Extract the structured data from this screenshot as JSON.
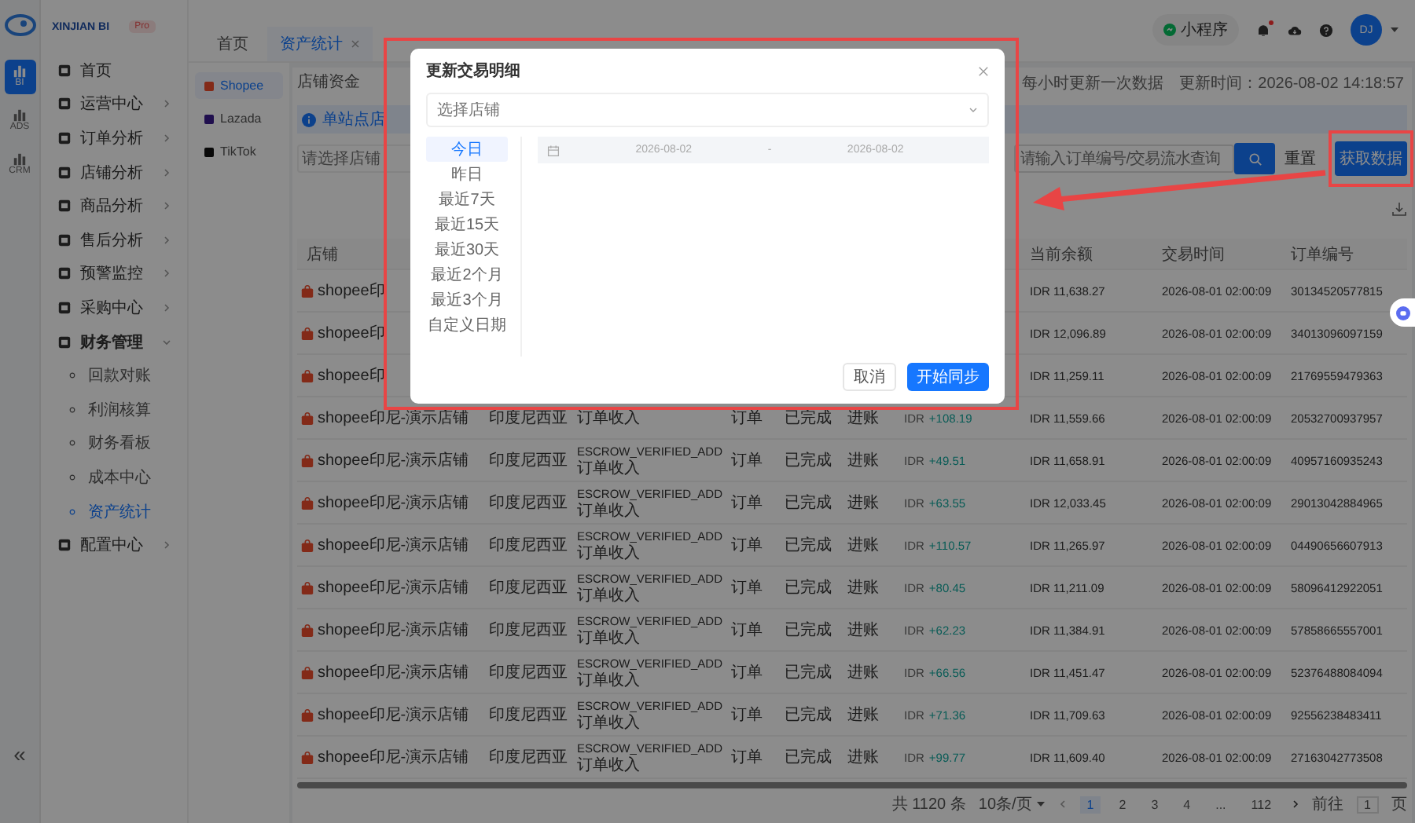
{
  "rail": {
    "items": [
      {
        "label": "BI",
        "selected": true
      },
      {
        "label": "ADS",
        "selected": false
      },
      {
        "label": "CRM",
        "selected": false
      }
    ],
    "collapse": "«"
  },
  "sidebar": {
    "brand": "XINJIAN BI",
    "badge": "Pro",
    "items": [
      {
        "label": "首页",
        "kind": "link"
      },
      {
        "label": "运营中心",
        "kind": "group",
        "expanded": false
      },
      {
        "label": "订单分析",
        "kind": "group",
        "expanded": false
      },
      {
        "label": "店铺分析",
        "kind": "group",
        "expanded": false
      },
      {
        "label": "商品分析",
        "kind": "group",
        "expanded": false
      },
      {
        "label": "售后分析",
        "kind": "group",
        "expanded": false
      },
      {
        "label": "预警监控",
        "kind": "group",
        "expanded": false
      },
      {
        "label": "采购中心",
        "kind": "group",
        "expanded": false
      },
      {
        "label": "财务管理",
        "kind": "group",
        "expanded": true,
        "children": [
          {
            "label": "回款对账",
            "selected": false
          },
          {
            "label": "利润核算",
            "selected": false
          },
          {
            "label": "财务看板",
            "selected": false
          },
          {
            "label": "成本中心",
            "selected": false
          },
          {
            "label": "资产统计",
            "selected": true
          }
        ]
      },
      {
        "label": "配置中心",
        "kind": "group",
        "expanded": false
      }
    ]
  },
  "topbar": {
    "tabs": [
      {
        "label": "首页",
        "selected": false,
        "closable": false
      },
      {
        "label": "资产统计",
        "selected": true,
        "closable": true
      }
    ],
    "mini_program": "小程序",
    "has_notification": true,
    "avatar": "DJ"
  },
  "platforms": [
    {
      "name": "Shopee",
      "selected": true
    },
    {
      "name": "Lazada",
      "selected": false
    },
    {
      "name": "TikTok",
      "selected": false
    }
  ],
  "content": {
    "tabs": [
      {
        "label": "店铺资金",
        "selected": false
      }
    ],
    "update_note": "每小时更新一次数据",
    "update_time": "更新时间：2026-08-02 14:18:57",
    "info": "单站点店",
    "filters": {
      "store_placeholder": "请选择店铺",
      "search_placeholder": "请输入订单编号/交易流水查询",
      "reset": "重置",
      "fetch": "获取数据"
    }
  },
  "table": {
    "columns": {
      "column_1": "店铺",
      "column_8": "当前余额",
      "column_9": "交易时间",
      "column_10": "订单编号"
    },
    "rows": [
      {
        "store": "shopee印",
        "balance": "IDR 11,638.27",
        "time": "2026-08-01 02:00:09",
        "order_no": "30134520577815"
      },
      {
        "store": "shopee印",
        "balance": "IDR 12,096.89",
        "time": "2026-08-01 02:00:09",
        "order_no": "34013096097159"
      },
      {
        "store": "shopee印",
        "balance": "IDR 11,259.11",
        "time": "2026-08-01 02:00:09",
        "order_no": "21769559479363"
      },
      {
        "store": "shopee印尼-演示店铺",
        "site": "印度尼西亚",
        "txn_type": "订单收入",
        "category": "订单",
        "status": "已完成",
        "direction": "进账",
        "currency": "IDR",
        "amount": "+108.19",
        "balance": "IDR 11,559.66",
        "time": "2026-08-01 02:00:09",
        "order_no": "20532700937957"
      },
      {
        "store": "shopee印尼-演示店铺",
        "site": "印度尼西亚",
        "txn_code": "ESCROW_VERIFIED_ADD",
        "txn_type": "订单收入",
        "category": "订单",
        "status": "已完成",
        "direction": "进账",
        "currency": "IDR",
        "amount": "+49.51",
        "balance": "IDR 11,658.91",
        "time": "2026-08-01 02:00:09",
        "order_no": "40957160935243"
      },
      {
        "store": "shopee印尼-演示店铺",
        "site": "印度尼西亚",
        "txn_code": "ESCROW_VERIFIED_ADD",
        "txn_type": "订单收入",
        "category": "订单",
        "status": "已完成",
        "direction": "进账",
        "currency": "IDR",
        "amount": "+63.55",
        "balance": "IDR 12,033.45",
        "time": "2026-08-01 02:00:09",
        "order_no": "29013042884965"
      },
      {
        "store": "shopee印尼-演示店铺",
        "site": "印度尼西亚",
        "txn_code": "ESCROW_VERIFIED_ADD",
        "txn_type": "订单收入",
        "category": "订单",
        "status": "已完成",
        "direction": "进账",
        "currency": "IDR",
        "amount": "+110.57",
        "balance": "IDR 11,265.97",
        "time": "2026-08-01 02:00:09",
        "order_no": "04490656607913"
      },
      {
        "store": "shopee印尼-演示店铺",
        "site": "印度尼西亚",
        "txn_code": "ESCROW_VERIFIED_ADD",
        "txn_type": "订单收入",
        "category": "订单",
        "status": "已完成",
        "direction": "进账",
        "currency": "IDR",
        "amount": "+80.45",
        "balance": "IDR 11,211.09",
        "time": "2026-08-01 02:00:09",
        "order_no": "58096412922051"
      },
      {
        "store": "shopee印尼-演示店铺",
        "site": "印度尼西亚",
        "txn_code": "ESCROW_VERIFIED_ADD",
        "txn_type": "订单收入",
        "category": "订单",
        "status": "已完成",
        "direction": "进账",
        "currency": "IDR",
        "amount": "+62.23",
        "balance": "IDR 11,384.91",
        "time": "2026-08-01 02:00:09",
        "order_no": "57858665557001"
      },
      {
        "store": "shopee印尼-演示店铺",
        "site": "印度尼西亚",
        "txn_code": "ESCROW_VERIFIED_ADD",
        "txn_type": "订单收入",
        "category": "订单",
        "status": "已完成",
        "direction": "进账",
        "currency": "IDR",
        "amount": "+66.56",
        "balance": "IDR 11,451.47",
        "time": "2026-08-01 02:00:09",
        "order_no": "52376488084094"
      },
      {
        "store": "shopee印尼-演示店铺",
        "site": "印度尼西亚",
        "txn_code": "ESCROW_VERIFIED_ADD",
        "txn_type": "订单收入",
        "category": "订单",
        "status": "已完成",
        "direction": "进账",
        "currency": "IDR",
        "amount": "+71.36",
        "balance": "IDR 11,709.63",
        "time": "2026-08-01 02:00:09",
        "order_no": "92556238483411"
      },
      {
        "store": "shopee印尼-演示店铺",
        "site": "印度尼西亚",
        "txn_code": "ESCROW_VERIFIED_ADD",
        "txn_type": "订单收入",
        "category": "订单",
        "status": "已完成",
        "direction": "进账",
        "currency": "IDR",
        "amount": "+99.77",
        "balance": "IDR 11,609.40",
        "time": "2026-08-01 02:00:09",
        "order_no": "27163042773508"
      }
    ]
  },
  "pagination": {
    "total": "共 1120 条",
    "page_size": "10条/页",
    "pages": [
      {
        "label": "1",
        "selected": true
      },
      {
        "label": "2",
        "selected": false
      },
      {
        "label": "3",
        "selected": false
      },
      {
        "label": "4",
        "selected": false
      },
      {
        "label": "...",
        "selected": false
      },
      {
        "label": "112",
        "selected": false
      }
    ],
    "goto": "前往",
    "goto_value": "1",
    "goto_suffix": "页"
  },
  "modal": {
    "title": "更新交易明细",
    "store_placeholder": "选择店铺",
    "shortcuts": [
      {
        "label": "今日",
        "selected": true
      },
      {
        "label": "昨日",
        "selected": false
      },
      {
        "label": "最近7天",
        "selected": false
      },
      {
        "label": "最近15天",
        "selected": false
      },
      {
        "label": "最近30天",
        "selected": false
      },
      {
        "label": "最近2个月",
        "selected": false
      },
      {
        "label": "最近3个月",
        "selected": false
      },
      {
        "label": "自定义日期",
        "selected": false
      }
    ],
    "start_date": "2026-08-02",
    "separator": "-",
    "end_date": "2026-08-02",
    "cancel": "取消",
    "confirm": "开始同步"
  }
}
